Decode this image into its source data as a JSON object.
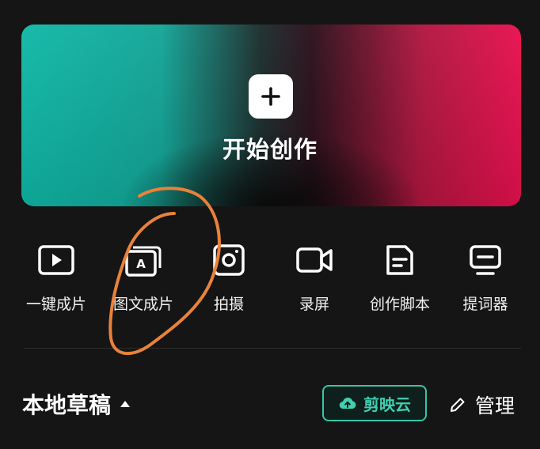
{
  "hero": {
    "title": "开始创作",
    "icon": "plus-icon"
  },
  "tools": [
    {
      "label": "一键成片",
      "icon": "play-square-icon"
    },
    {
      "label": "图文成片",
      "icon": "text-to-video-icon"
    },
    {
      "label": "拍摄",
      "icon": "camera-icon"
    },
    {
      "label": "录屏",
      "icon": "video-record-icon"
    },
    {
      "label": "创作脚本",
      "icon": "script-document-icon"
    },
    {
      "label": "提词器",
      "icon": "teleprompter-icon"
    }
  ],
  "drafts": {
    "title": "本地草稿"
  },
  "cloud": {
    "label": "剪映云",
    "icon": "cloud-upload-icon"
  },
  "manage": {
    "label": "管理",
    "icon": "pencil-icon"
  },
  "colors": {
    "accent": "#35c6a9",
    "background": "#151515",
    "annotation": "#e8823a"
  }
}
